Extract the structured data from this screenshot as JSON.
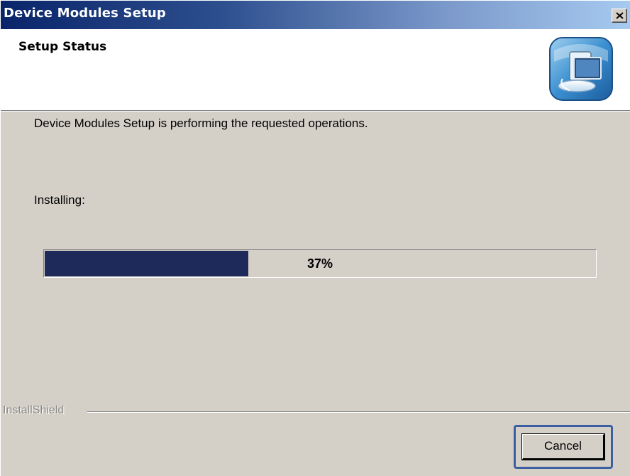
{
  "window": {
    "title": "Device Modules Setup",
    "close_icon": "close-icon"
  },
  "header": {
    "title": "Setup Status",
    "icon": "computer-setup-icon"
  },
  "body": {
    "description": "Device Modules Setup is performing the requested operations.",
    "status_label": "Installing:"
  },
  "progress": {
    "percent": 37,
    "label": "37%",
    "fill_color": "#1e2a5a"
  },
  "footer": {
    "brand": "InstallShield",
    "cancel_label": "Cancel"
  },
  "colors": {
    "titlebar_start": "#0a246a",
    "titlebar_end": "#a6caf0",
    "dialog_bg": "#d4d0c8",
    "focus_ring": "#3b5fa0"
  }
}
